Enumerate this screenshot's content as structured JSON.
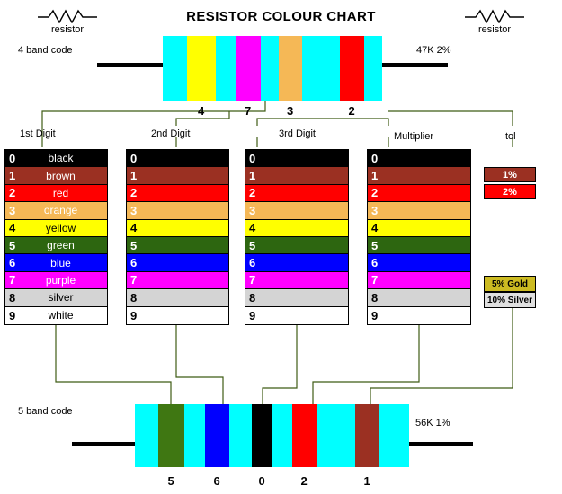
{
  "title": "RESISTOR COLOUR CHART",
  "symbols": {
    "left": {
      "label": "resistor",
      "icon": "resistor-zigzag-icon"
    },
    "right": {
      "label": "resistor",
      "icon": "resistor-zigzag-icon"
    }
  },
  "four_band": {
    "caption": "4 band code",
    "value": "47K  2%",
    "body_color": "#00ffff",
    "bands": [
      {
        "digit": "4",
        "color_name": "yellow",
        "color": "#ffff00"
      },
      {
        "digit": "7",
        "color_name": "purple",
        "color": "#ff00ff"
      },
      {
        "digit": "3",
        "color_name": "orange",
        "color": "#f5b856"
      },
      {
        "digit": "2",
        "color_name": "red",
        "color": "#ff0000"
      }
    ],
    "band_labels": [
      "1st Digit",
      "2nd Digit",
      "3rd Digit",
      "Multiplier",
      "tol"
    ]
  },
  "five_band": {
    "caption": "5 band code",
    "value": "56K  1%",
    "body_color": "#00ffff",
    "bands": [
      {
        "digit": "5",
        "color_name": "green",
        "color": "#3f7712"
      },
      {
        "digit": "6",
        "color_name": "blue",
        "color": "#0000ff"
      },
      {
        "digit": "0",
        "color_name": "black",
        "color": "#000000"
      },
      {
        "digit": "2",
        "color_name": "red",
        "color": "#ff0000"
      },
      {
        "digit": "1",
        "color_name": "brown",
        "color": "#9b3022"
      }
    ]
  },
  "colour_table": {
    "rows": [
      {
        "digit": "0",
        "name": "black",
        "bg": "#000000",
        "fg": "#ffffff"
      },
      {
        "digit": "1",
        "name": "brown",
        "bg": "#9b3022",
        "fg": "#ffffff"
      },
      {
        "digit": "2",
        "name": "red",
        "bg": "#ff0000",
        "fg": "#ffffff"
      },
      {
        "digit": "3",
        "name": "orange",
        "bg": "#f5b856",
        "fg": "#ffffff"
      },
      {
        "digit": "4",
        "name": "yellow",
        "bg": "#ffff00",
        "fg": "#000000"
      },
      {
        "digit": "5",
        "name": "green",
        "bg": "#2d6610",
        "fg": "#ffffff"
      },
      {
        "digit": "6",
        "name": "blue",
        "bg": "#0000ff",
        "fg": "#ffffff"
      },
      {
        "digit": "7",
        "name": "purple",
        "bg": "#ff00ff",
        "fg": "#ffffff"
      },
      {
        "digit": "8",
        "name": "silver",
        "bg": "#d4d4d4",
        "fg": "#000000"
      },
      {
        "digit": "9",
        "name": "white",
        "bg": "#ffffff",
        "fg": "#000000"
      }
    ]
  },
  "tolerances": {
    "percent": [
      {
        "label": "1%",
        "bg": "#9b3022",
        "fg": "#ffffff"
      },
      {
        "label": "2%",
        "bg": "#ff0000",
        "fg": "#ffffff"
      }
    ],
    "metal": [
      {
        "label": "5% Gold",
        "bg": "#ccbb22",
        "fg": "#000000"
      },
      {
        "label": "10% Silver",
        "bg": "#e0e0e0",
        "fg": "#000000"
      }
    ]
  },
  "connector_color": "#3f5c15"
}
